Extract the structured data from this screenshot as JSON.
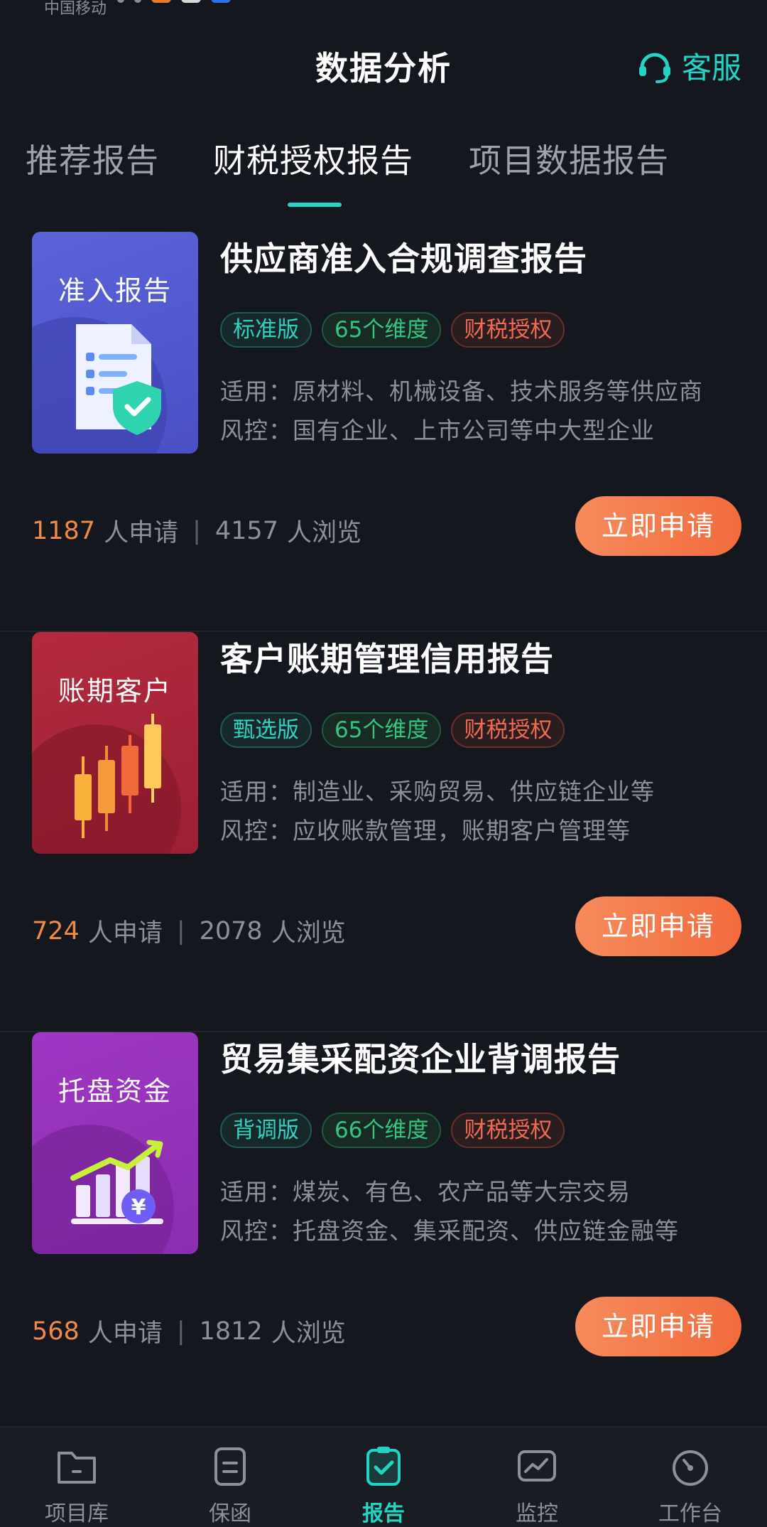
{
  "status": {
    "carrier": "中国移动",
    "right_text": ""
  },
  "header": {
    "title": "数据分析",
    "service_label": "客服"
  },
  "tabs": [
    {
      "label": "推荐报告",
      "active": false
    },
    {
      "label": "财税授权报告",
      "active": true
    },
    {
      "label": "项目数据报告",
      "active": false
    }
  ],
  "reports": [
    {
      "thumb_label": "准入报告",
      "title": "供应商准入合规调查报告",
      "tags": [
        "标准版",
        "65个维度",
        "财税授权"
      ],
      "usage": "适用：原材料、机械设备、技术服务等供应商",
      "risk": "风控：国有企业、上市公司等中大型企业",
      "applicants": "1187",
      "applicants_suffix": "人申请",
      "separator": "|",
      "views": "4157",
      "views_suffix": "人浏览",
      "button": "立即申请"
    },
    {
      "thumb_label": "账期客户",
      "title": "客户账期管理信用报告",
      "tags": [
        "甄选版",
        "65个维度",
        "财税授权"
      ],
      "usage": "适用：制造业、采购贸易、供应链企业等",
      "risk": "风控：应收账款管理，账期客户管理等",
      "applicants": "724",
      "applicants_suffix": "人申请",
      "separator": "|",
      "views": "2078",
      "views_suffix": "人浏览",
      "button": "立即申请"
    },
    {
      "thumb_label": "托盘资金",
      "title": "贸易集采配资企业背调报告",
      "tags": [
        "背调版",
        "66个维度",
        "财税授权"
      ],
      "usage": "适用：煤炭、有色、农产品等大宗交易",
      "risk": "风控：托盘资金、集采配资、供应链金融等",
      "applicants": "568",
      "applicants_suffix": "人申请",
      "separator": "|",
      "views": "1812",
      "views_suffix": "人浏览",
      "button": "立即申请"
    }
  ],
  "bottom_nav": [
    {
      "label": "项目库",
      "icon": "folder-icon",
      "active": false
    },
    {
      "label": "保函",
      "icon": "document-icon",
      "active": false
    },
    {
      "label": "报告",
      "icon": "report-check-icon",
      "active": true
    },
    {
      "label": "监控",
      "icon": "trend-chart-icon",
      "active": false
    },
    {
      "label": "工作台",
      "icon": "dashboard-gauge-icon",
      "active": false
    }
  ],
  "colors": {
    "background": "#15171e",
    "accent": "#23d3c3",
    "orange": "#f08a45",
    "button_gradient_start": "#f68b5c",
    "button_gradient_end": "#f26b3d"
  }
}
